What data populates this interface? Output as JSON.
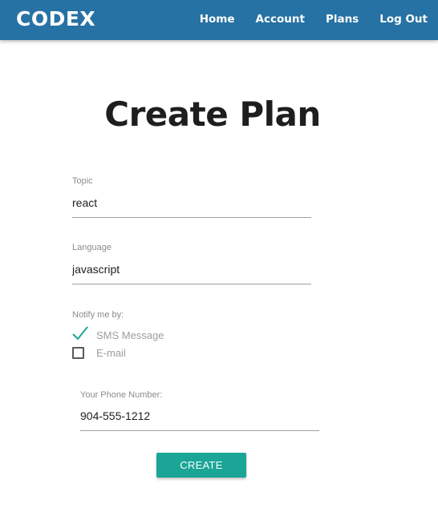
{
  "nav": {
    "brand": "CODEX",
    "links": [
      "Home",
      "Account",
      "Plans",
      "Log Out"
    ]
  },
  "page": {
    "title": "Create Plan"
  },
  "form": {
    "topic": {
      "label": "Topic",
      "value": "react"
    },
    "language": {
      "label": "Language",
      "value": "javascript"
    },
    "notify": {
      "label": "Notify me by:",
      "options": [
        {
          "label": "SMS Message",
          "checked": true
        },
        {
          "label": "E-mail",
          "checked": false
        }
      ]
    },
    "phone": {
      "label": "Your Phone Number:",
      "value": "904-555-1212"
    },
    "submit_label": "CREATE"
  },
  "colors": {
    "navbar": "#2672a4",
    "accent": "#1aa596",
    "checkmark": "#1aa596"
  },
  "icons": {
    "sms_checkbox": "checkmark-icon",
    "email_checkbox": "empty-checkbox-icon"
  }
}
